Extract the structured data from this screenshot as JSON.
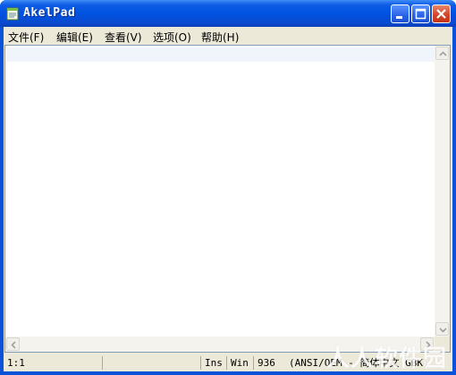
{
  "window": {
    "title": "AkelPad"
  },
  "menu": [
    {
      "label": "文件(F)"
    },
    {
      "label": "编辑(E)"
    },
    {
      "label": "查看(V)"
    },
    {
      "label": "选项(O)"
    },
    {
      "label": "帮助(H)"
    }
  ],
  "status": {
    "position": "1:1",
    "insert_mode": "Ins",
    "newline": "Win",
    "codepage": "936",
    "encoding": "(ANSI/OEM - 简体中文 GBK)"
  },
  "watermark": "人人软件园",
  "icons": [
    "notepad-icon",
    "minimize-icon",
    "maximize-icon",
    "close-icon",
    "scroll-up-icon",
    "scroll-down-icon",
    "scroll-left-icon",
    "scroll-right-icon"
  ],
  "colors": {
    "titlebar": "#0052e0",
    "face": "#ece9d8",
    "current_line": "#f0f4fb",
    "close": "#d4462a"
  }
}
